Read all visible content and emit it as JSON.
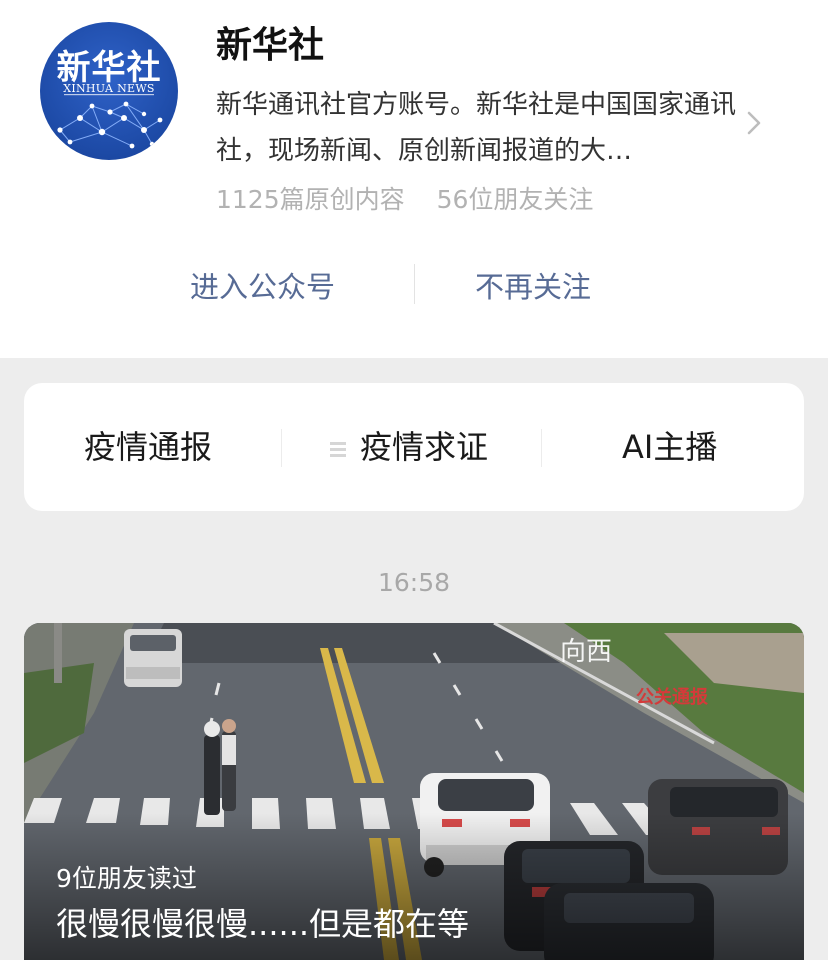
{
  "account": {
    "avatar_logo": "新华社",
    "avatar_subtitle": "XINHUA NEWS",
    "name": "新华社",
    "description": "新华通讯社官方账号。新华社是中国国家通讯社，现场新闻、原创新闻报道的大…",
    "original_count": "1125篇原创内容",
    "friends_following": "56位朋友关注",
    "icons": {
      "chevron": "chevron-right-icon"
    }
  },
  "actions": {
    "enter": "进入公众号",
    "unfollow": "不再关注",
    "link_color": "#576b95"
  },
  "menu": {
    "items": [
      {
        "label": "疫情通报"
      },
      {
        "label": "疫情求证",
        "icon": "menu-lines-icon"
      },
      {
        "label": "AI主播"
      }
    ]
  },
  "timestamp": "16:58",
  "article": {
    "camera_label": "向西",
    "camera_mark": "公关通报",
    "readers": "9位朋友读过",
    "headline": "很慢很慢很慢......但是都在等"
  }
}
